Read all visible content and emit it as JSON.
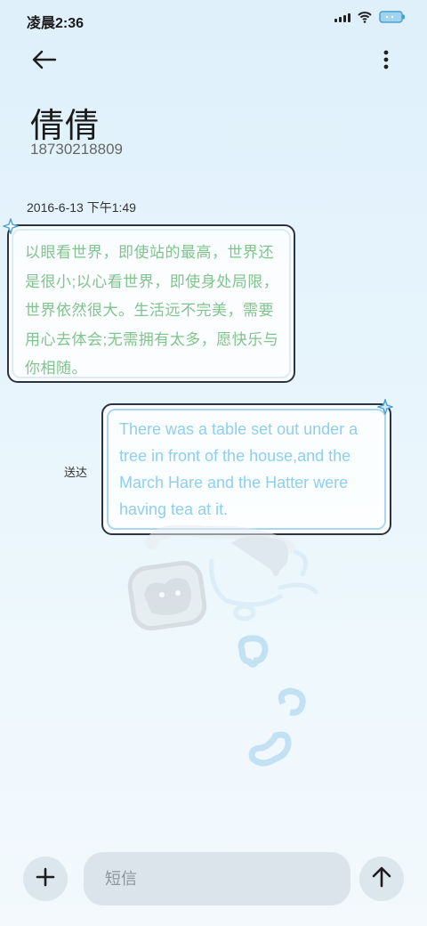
{
  "status_bar": {
    "time": "凌晨2:36",
    "icons": [
      "signal-icon",
      "wifi-icon",
      "battery-icon"
    ]
  },
  "header": {
    "back_icon": "back-arrow-icon",
    "more_icon": "more-vertical-icon",
    "contact_name": "倩倩",
    "contact_number": "18730218809"
  },
  "conversation": {
    "timestamp": "2016-6-13 下午1:49",
    "messages": [
      {
        "direction": "incoming",
        "text": "以眼看世界，即使站的最高，世界还是很小;以心看世界，即使身处局限，世界依然很大。生活远不完美，需要用心去体会;无需拥有太多，愿快乐与你相随。"
      },
      {
        "direction": "outgoing",
        "text": "There was a table set out under a tree in front of the house,and the March Hare and the Hatter were having tea at it.",
        "status": "送达"
      }
    ]
  },
  "composer": {
    "add_icon": "plus-icon",
    "placeholder": "短信",
    "send_icon": "send-arrow-icon"
  },
  "colors": {
    "incoming_text": "#7fc48c",
    "outgoing_text": "#8fcfee",
    "bubble_border": "#2b3440",
    "background": "#e8f5fc"
  }
}
